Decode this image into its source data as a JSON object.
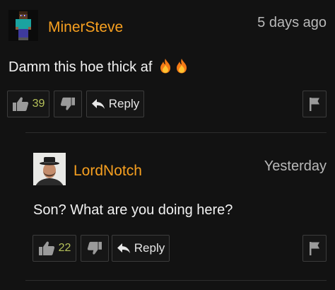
{
  "colors": {
    "background": "#121212",
    "username": "#f7a020",
    "timestamp": "#b9b9b9",
    "body_text": "#f2f2f2",
    "like_count": "#b6c25a",
    "button_border": "#3c3c3c"
  },
  "comments": [
    {
      "username": "MinerSteve",
      "timestamp": "5 days ago",
      "text": "Damm this hoe thick af",
      "emoji": [
        "fire-icon",
        "fire-icon"
      ],
      "likes": "39",
      "reply_label": "Reply"
    },
    {
      "username": "LordNotch",
      "timestamp": "Yesterday",
      "text": "Son? What are you doing here?",
      "likes": "22",
      "reply_label": "Reply"
    }
  ]
}
